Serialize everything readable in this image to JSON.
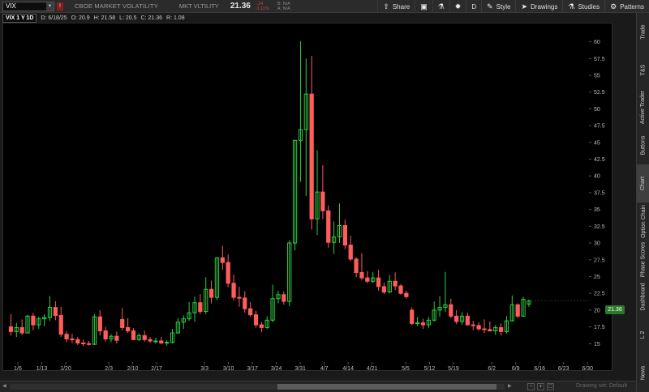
{
  "header": {
    "symbol": "VIX",
    "description": "CBOE MARKET VOLATILITY",
    "short_name": "MKT VLTILITY",
    "last": "21.36",
    "change": "-.24",
    "change_pct": "-1.11%",
    "bid": "B: N/A",
    "ask": "A: N/A",
    "toolbar": [
      {
        "label": "Share",
        "icon": "share-icon"
      },
      {
        "label": "",
        "icon": "screenshot-icon"
      },
      {
        "label": "",
        "icon": "flask-icon"
      },
      {
        "label": "",
        "icon": "gear-icon"
      },
      {
        "label": "D",
        "icon": ""
      },
      {
        "label": "Style",
        "icon": "style-icon"
      },
      {
        "label": "Drawings",
        "icon": "cursor-icon"
      },
      {
        "label": "Studies",
        "icon": "flask-icon"
      },
      {
        "label": "Patterns",
        "icon": "patterns-icon"
      }
    ]
  },
  "infobar": {
    "timeframe": "VIX 1 Y 1D",
    "date": "D: 6/18/25",
    "open": "O: 20.9",
    "high": "H: 21.58",
    "low": "L: 20.5",
    "close": "C: 21.36",
    "range": "R: 1.08"
  },
  "sidebar_tabs": [
    "Trade",
    "T&S",
    "Active Trader",
    "Buttons",
    "Chart",
    "Option Chain",
    "Phase Scores",
    "Dashboard",
    "L 2",
    "News"
  ],
  "active_tab": "Chart",
  "bottom": {
    "drawing_set": "Drawing set: Default"
  },
  "chart_data": {
    "type": "candlestick",
    "title": "",
    "ylim": [
      12.5,
      62
    ],
    "y_ticks": [
      "15",
      "17.5",
      "20",
      "22.5",
      "25",
      "27.5",
      "30",
      "32.5",
      "35",
      "37.5",
      "40",
      "42.5",
      "45",
      "47.5",
      "50",
      "52.5",
      "55",
      "57.5",
      "60"
    ],
    "x_ticks": [
      "1/6",
      "1/13",
      "1/20",
      "2/3",
      "2/10",
      "2/17",
      "3/3",
      "3/10",
      "3/17",
      "3/24",
      "3/31",
      "4/7",
      "4/14",
      "4/21",
      "5/5",
      "5/12",
      "5/19",
      "6/2",
      "6/9",
      "6/16",
      "6/23",
      "6/30"
    ],
    "current_price": "21.36",
    "up_color": "#2ecc40",
    "down_color": "#ff5c5c",
    "candles": [
      [
        17.5,
        19.4,
        16.2,
        16.8
      ],
      [
        16.8,
        18.1,
        16.0,
        17.4
      ],
      [
        17.4,
        18.6,
        16.3,
        16.6
      ],
      [
        16.6,
        19.3,
        16.5,
        19.1
      ],
      [
        19.1,
        19.6,
        17.0,
        17.8
      ],
      [
        17.8,
        19.0,
        17.2,
        18.7
      ],
      [
        18.7,
        19.4,
        17.6,
        18.9
      ],
      [
        18.9,
        22.1,
        18.4,
        20.4
      ],
      [
        20.4,
        21.3,
        18.5,
        19.2
      ],
      [
        19.2,
        20.5,
        16.0,
        16.4
      ],
      [
        16.4,
        16.9,
        15.2,
        15.7
      ],
      [
        15.7,
        16.5,
        15.1,
        15.6
      ],
      [
        15.6,
        16.0,
        14.8,
        15.1
      ],
      [
        15.1,
        15.6,
        14.6,
        15.0
      ],
      [
        15.0,
        15.4,
        14.7,
        14.9
      ],
      [
        14.9,
        19.4,
        14.8,
        19.0
      ],
      [
        19.0,
        20.0,
        16.2,
        16.9
      ],
      [
        16.9,
        17.5,
        15.3,
        15.7
      ],
      [
        15.7,
        16.4,
        15.2,
        16.1
      ],
      [
        16.1,
        16.8,
        15.0,
        15.5
      ],
      [
        18.6,
        20.3,
        17.0,
        17.4
      ],
      [
        17.4,
        18.8,
        16.6,
        16.9
      ],
      [
        16.9,
        17.3,
        15.5,
        15.6
      ],
      [
        15.6,
        16.5,
        15.4,
        16.2
      ],
      [
        16.2,
        16.9,
        15.3,
        15.6
      ],
      [
        15.6,
        16.0,
        15.1,
        15.4
      ],
      [
        15.4,
        15.9,
        15.0,
        15.4
      ],
      [
        15.4,
        16.0,
        14.9,
        15.1
      ],
      [
        15.1,
        15.5,
        14.7,
        15.2
      ],
      [
        15.2,
        17.2,
        15.0,
        16.6
      ],
      [
        16.6,
        18.8,
        16.5,
        18.2
      ],
      [
        18.2,
        19.2,
        17.2,
        18.7
      ],
      [
        18.7,
        21.2,
        18.4,
        19.6
      ],
      [
        19.6,
        22.0,
        18.3,
        21.1
      ],
      [
        21.1,
        22.4,
        19.4,
        19.8
      ],
      [
        19.8,
        24.9,
        19.4,
        23.1
      ],
      [
        23.1,
        24.4,
        21.0,
        21.9
      ],
      [
        21.9,
        27.9,
        21.5,
        27.8
      ],
      [
        27.8,
        29.6,
        26.0,
        27.1
      ],
      [
        27.1,
        28.3,
        23.4,
        24.0
      ],
      [
        24.0,
        25.3,
        21.4,
        21.9
      ],
      [
        21.9,
        23.5,
        20.5,
        21.8
      ],
      [
        21.8,
        22.8,
        19.6,
        20.2
      ],
      [
        20.2,
        21.2,
        19.0,
        19.3
      ],
      [
        19.3,
        19.9,
        17.4,
        17.8
      ],
      [
        17.8,
        18.2,
        16.7,
        17.4
      ],
      [
        17.4,
        19.1,
        17.2,
        18.5
      ],
      [
        18.5,
        23.8,
        18.2,
        21.7
      ],
      [
        21.7,
        22.9,
        21.0,
        22.3
      ],
      [
        22.3,
        22.8,
        20.8,
        21.3
      ],
      [
        21.3,
        30.4,
        20.6,
        30.0
      ],
      [
        30.0,
        45.3,
        28.9,
        45.3
      ],
      [
        45.3,
        60.1,
        39.1,
        46.9
      ],
      [
        46.9,
        57.5,
        37.0,
        52.2
      ],
      [
        52.2,
        57.9,
        32.0,
        33.6
      ],
      [
        33.6,
        43.8,
        31.2,
        37.6
      ],
      [
        37.6,
        41.6,
        33.6,
        34.8
      ],
      [
        34.8,
        35.6,
        29.3,
        30.1
      ],
      [
        30.1,
        33.2,
        28.4,
        30.9
      ],
      [
        30.9,
        35.9,
        30.0,
        32.6
      ],
      [
        32.6,
        33.5,
        29.1,
        29.7
      ],
      [
        29.7,
        31.1,
        27.3,
        27.6
      ],
      [
        27.6,
        27.9,
        24.9,
        25.6
      ],
      [
        25.6,
        28.5,
        24.5,
        24.8
      ],
      [
        24.8,
        25.8,
        24.0,
        24.3
      ],
      [
        24.3,
        25.7,
        24.0,
        24.8
      ],
      [
        24.8,
        26.0,
        22.9,
        23.5
      ],
      [
        23.5,
        24.1,
        22.4,
        22.7
      ],
      [
        22.7,
        25.2,
        22.5,
        24.3
      ],
      [
        24.3,
        25.6,
        23.0,
        23.6
      ],
      [
        23.6,
        23.9,
        22.3,
        22.5
      ],
      [
        22.5,
        22.9,
        21.7,
        22.0
      ],
      [
        20.0,
        20.4,
        17.8,
        18.0
      ],
      [
        18.0,
        19.0,
        17.6,
        18.1
      ],
      [
        18.1,
        18.7,
        17.2,
        17.8
      ],
      [
        17.8,
        19.0,
        17.3,
        18.5
      ],
      [
        18.5,
        21.3,
        18.3,
        20.0
      ],
      [
        20.0,
        22.1,
        19.0,
        20.4
      ],
      [
        20.4,
        25.7,
        19.7,
        20.8
      ],
      [
        20.8,
        21.7,
        18.8,
        19.1
      ],
      [
        19.1,
        20.0,
        17.9,
        18.3
      ],
      [
        18.3,
        19.7,
        17.8,
        19.1
      ],
      [
        19.1,
        19.6,
        17.7,
        17.8
      ],
      [
        17.8,
        18.4,
        17.0,
        17.7
      ],
      [
        17.7,
        18.2,
        16.9,
        17.2
      ],
      [
        17.2,
        18.6,
        16.6,
        17.1
      ],
      [
        17.1,
        18.3,
        16.8,
        16.9
      ],
      [
        16.9,
        17.8,
        16.3,
        17.4
      ],
      [
        17.4,
        18.0,
        16.2,
        16.8
      ],
      [
        16.8,
        19.1,
        16.5,
        18.4
      ],
      [
        18.4,
        22.2,
        18.3,
        20.8
      ],
      [
        20.8,
        21.0,
        18.8,
        19.1
      ],
      [
        19.1,
        22.0,
        19.0,
        21.6
      ],
      [
        20.9,
        21.58,
        20.5,
        21.36
      ]
    ]
  }
}
